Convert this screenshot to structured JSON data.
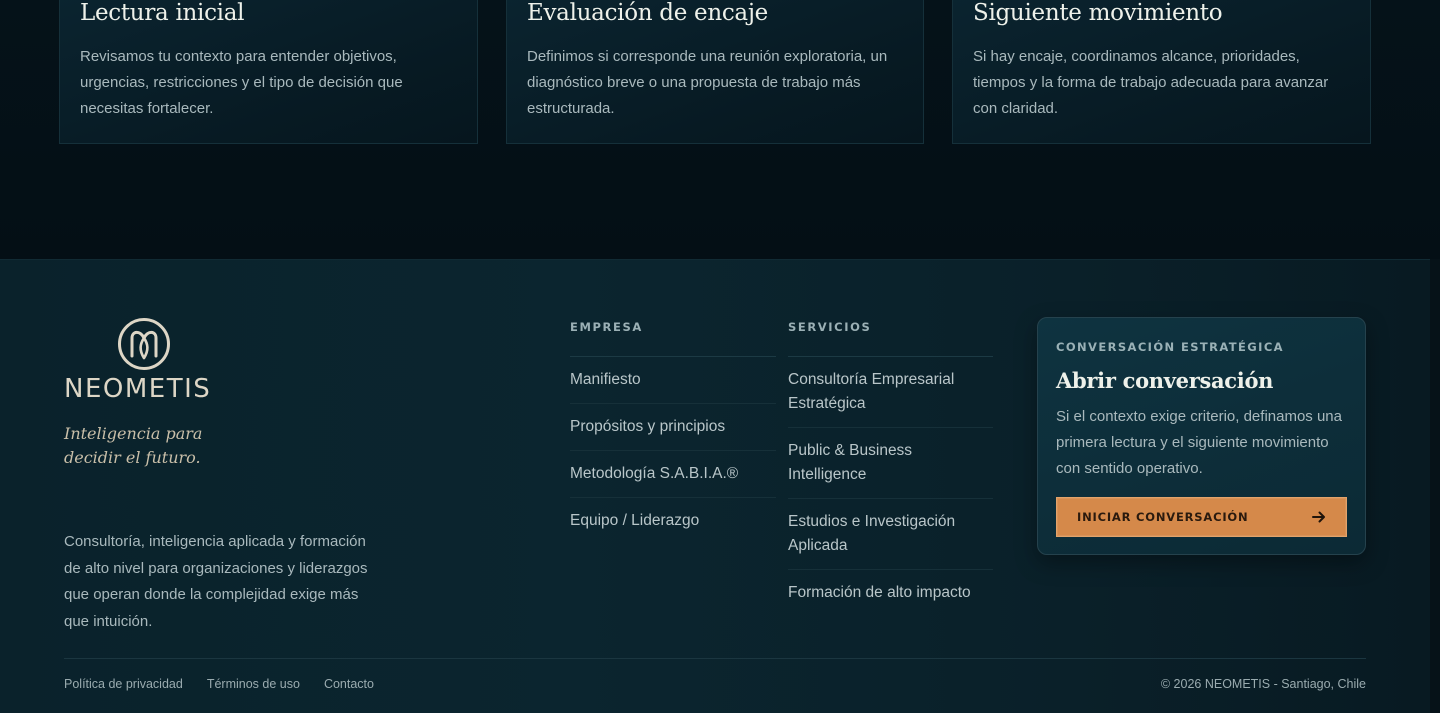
{
  "steps": [
    {
      "title": "Lectura inicial",
      "body": "Revisamos tu contexto para entender objetivos, urgencias, restricciones y el tipo de decisión que necesitas fortalecer."
    },
    {
      "title": "Evaluación de encaje",
      "body": "Definimos si corresponde una reunión exploratoria, un diagnóstico breve o una propuesta de trabajo más estructurada."
    },
    {
      "title": "Siguiente movimiento",
      "body": "Si hay encaje, coordinamos alcance, prioridades, tiempos y la forma de trabajo adecuada para avanzar con claridad."
    }
  ],
  "brand": {
    "logo_icon": "neometis-monogram-icon",
    "name": "NEOMETIS",
    "tagline": "Inteligencia para decidir el futuro.",
    "description": "Consultoría, inteligencia aplicada y formación de alto nivel para organizaciones y liderazgos que operan donde la complejidad exige más que intuición."
  },
  "columns": {
    "empresa": {
      "heading": "EMPRESA",
      "links": [
        "Manifiesto",
        "Propósitos y principios",
        "Metodología S.A.B.I.A.®",
        "Equipo / Liderazgo"
      ]
    },
    "servicios": {
      "heading": "SERVICIOS",
      "links": [
        "Consultoría Empresarial Estratégica",
        "Public & Business Intelligence",
        "Estudios e Investigación Aplicada",
        "Formación de alto impacto"
      ]
    }
  },
  "cta": {
    "eyebrow": "CONVERSACIÓN ESTRATÉGICA",
    "title": "Abrir conversación",
    "body": "Si el contexto exige criterio, definamos una primera lectura y el siguiente movimiento con sentido operativo.",
    "button_label": "INICIAR CONVERSACIÓN",
    "button_icon": "arrow-right-icon",
    "accent_color": "#d5894a"
  },
  "legal": {
    "links": [
      "Política de privacidad",
      "Términos de uso",
      "Contacto"
    ],
    "copyright": "© 2026 NEOMETIS - Santiago, Chile"
  }
}
